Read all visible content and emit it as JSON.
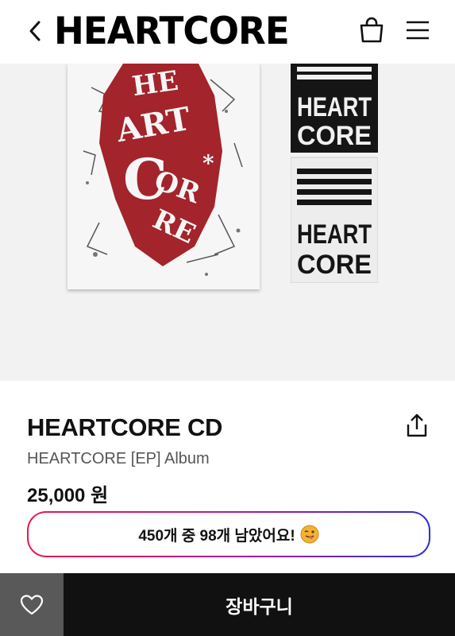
{
  "header": {
    "logo_text": "HEARTCORE",
    "back_icon": "chevron-left-icon",
    "bag_icon": "shopping-bag-icon",
    "menu_icon": "hamburger-menu-icon"
  },
  "hero": {
    "book_cover_text": "HEARTCORE",
    "card_text_line1": "HEART",
    "card_text_line2": "CORE"
  },
  "product": {
    "title": "HEARTCORE CD",
    "subtitle": "HEARTCORE [EP] Album",
    "price": "25,000 원",
    "share_icon": "share-icon"
  },
  "stock": {
    "message": "450개 중 98개 남았어요!",
    "emoji_icon": "tongue-out-emoji-icon"
  },
  "footer": {
    "like_icon": "heart-outline-icon",
    "cart_label": "장바구니"
  },
  "colors": {
    "accent_gradient_start": "#e8194a",
    "accent_gradient_end": "#2c2fd6",
    "cover_red": "#a3242b",
    "bottom_bar_dark": "#111111",
    "like_button_gray": "#595959"
  }
}
